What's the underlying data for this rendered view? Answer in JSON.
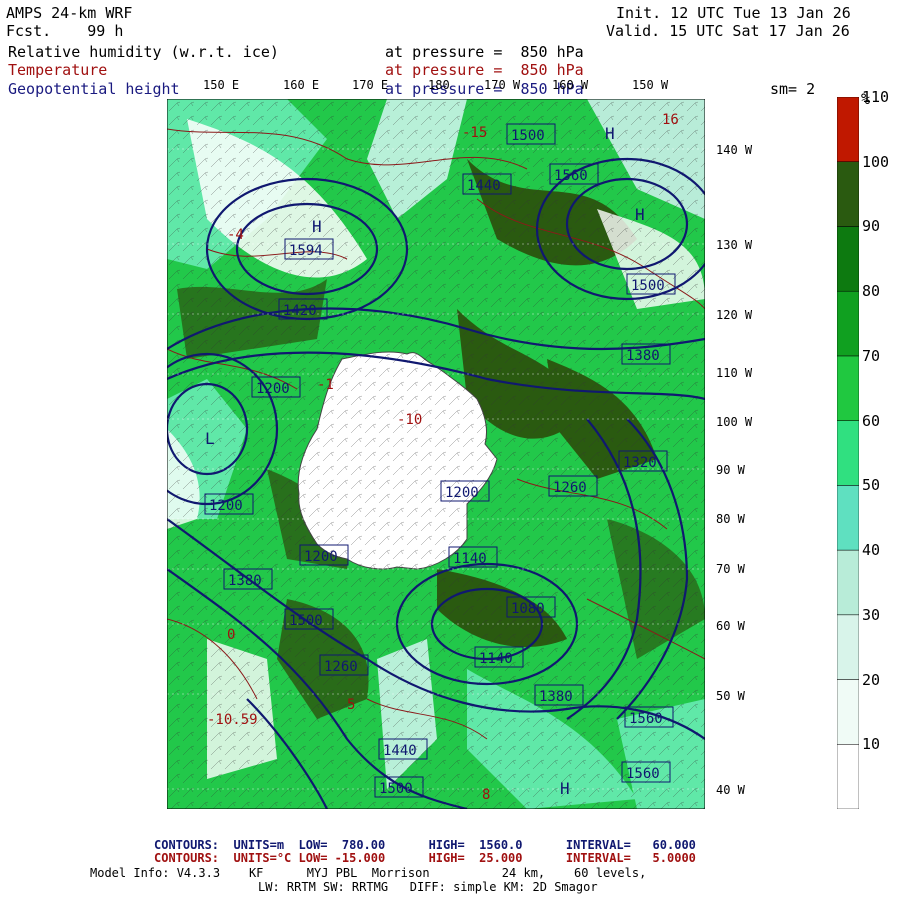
{
  "header": {
    "model": "AMPS 24-km WRF",
    "fcst": "Fcst.    99 h",
    "init": "Init. 12 UTC Tue 13 Jan 26",
    "valid": "Valid. 15 UTC Sat 17 Jan 26",
    "field1_name": "Relative humidity (w.r.t. ice)",
    "field1_level": "at pressure =  850 hPa",
    "field2_name": "Temperature",
    "field2_level": "at pressure =  850 hPa",
    "field3_name": "Geopotential height",
    "field3_level": "at pressure =  850 hPa",
    "smoothing": "sm= 2"
  },
  "longitude_labels_top": [
    "150 E",
    "160 E",
    "170 E",
    "180",
    "170 W",
    "160 W",
    "150 W"
  ],
  "latitude_labels_right": [
    "140 W",
    "130 W",
    "120 W",
    "110 W",
    "100 W",
    "90 W",
    "80 W",
    "70 W",
    "60 W",
    "50 W",
    "40 W"
  ],
  "colorbar": {
    "unit": "%",
    "ticks": [
      "10",
      "20",
      "30",
      "40",
      "50",
      "60",
      "70",
      "80",
      "90",
      "100",
      "110"
    ],
    "colors": [
      "#ffffff",
      "#f0fbf6",
      "#d8f4ea",
      "#b8ecd8",
      "#5fe0c0",
      "#30e080",
      "#20c840",
      "#10a020",
      "#0d7a10",
      "#2a5a10",
      "#c01800"
    ]
  },
  "map_labels": {
    "height_labels": [
      "1500",
      "1440",
      "1560",
      "1594",
      "1500",
      "1380",
      "1420",
      "1260",
      "1200",
      "1200",
      "1320",
      "1200",
      "1140",
      "1380",
      "1500",
      "1560",
      "1440",
      "1500",
      "1380",
      "1560",
      "1080",
      "1140",
      "1260",
      "1320",
      "1200"
    ],
    "temperature_labels": [
      "-15",
      "-10",
      "0",
      "5",
      "8",
      "-10.59",
      "-4",
      "16",
      "-1"
    ],
    "pressure_centers": [
      "H",
      "H",
      "H",
      "H",
      "L"
    ]
  },
  "footer": {
    "line1_prefix": "CONTOURS:",
    "line1_units": "UNITS=m",
    "line1_low": "LOW=  780.00",
    "line1_high": "HIGH=  1560.0",
    "line1_interval": "INTERVAL=   60.000",
    "line2_prefix": "CONTOURS:",
    "line2_units": "UNITS=°C",
    "line2_low": "LOW= -15.000",
    "line2_high": "HIGH=  25.000",
    "line2_interval": "INTERVAL=   5.0000",
    "line3": "Model Info: V4.3.3    KF      MYJ PBL  Morrison          24 km,    60 levels,",
    "line4": "LW: RRTM SW: RRTMG   DIFF: simple KM: 2D Smagor"
  }
}
